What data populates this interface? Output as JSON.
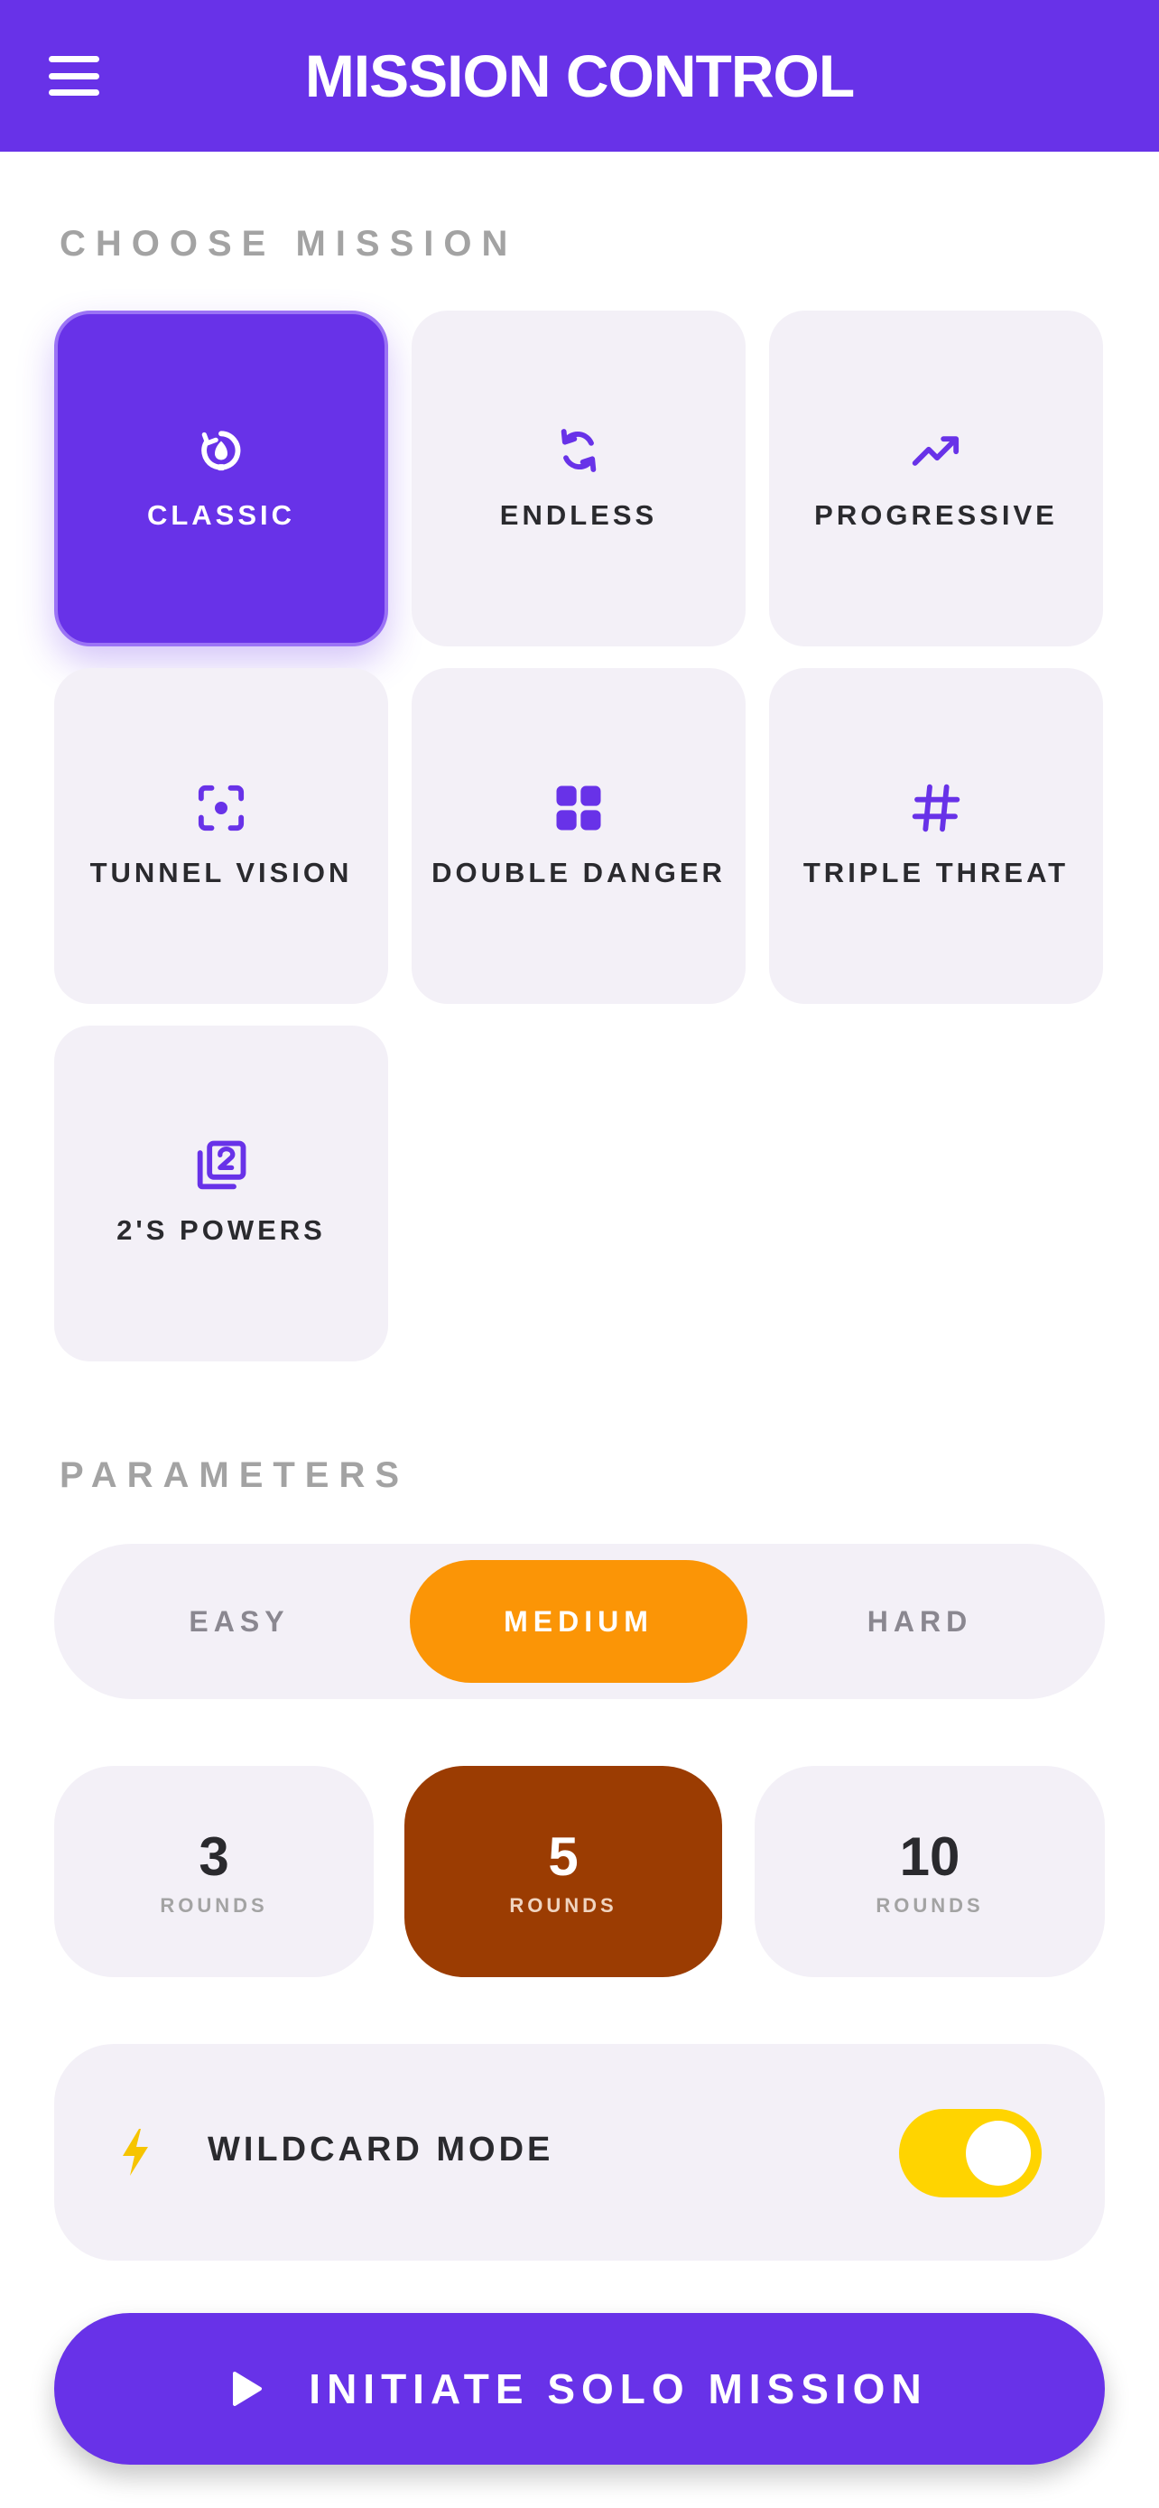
{
  "header": {
    "title": "MISSION CONTROL",
    "menu_icon": "hamburger-menu-icon"
  },
  "sections": {
    "mission_label": "CHOOSE MISSION",
    "parameters_label": "PARAMETERS"
  },
  "missions": [
    {
      "label": "CLASSIC",
      "icon": "classic-icon",
      "selected": true
    },
    {
      "label": "ENDLESS",
      "icon": "refresh-icon",
      "selected": false
    },
    {
      "label": "PROGRESSIVE",
      "icon": "trending-up-icon",
      "selected": false
    },
    {
      "label": "TUNNEL VISION",
      "icon": "focus-icon",
      "selected": false
    },
    {
      "label": "DOUBLE DANGER",
      "icon": "grid-icon",
      "selected": false
    },
    {
      "label": "TRIPLE THREAT",
      "icon": "hashtag-icon",
      "selected": false
    },
    {
      "label": "2'S POWERS",
      "icon": "filter-2-icon",
      "selected": false
    }
  ],
  "difficulty": {
    "options": [
      "EASY",
      "MEDIUM",
      "HARD"
    ],
    "selected": "MEDIUM"
  },
  "rounds": {
    "options": [
      {
        "value": "3",
        "unit": "ROUNDS"
      },
      {
        "value": "5",
        "unit": "ROUNDS"
      },
      {
        "value": "10",
        "unit": "ROUNDS"
      }
    ],
    "selected": "5"
  },
  "wildcard": {
    "label": "WILDCARD MODE",
    "icon": "bolt-icon",
    "enabled": true
  },
  "cta": {
    "label": "INITIATE SOLO MISSION",
    "icon": "play-icon"
  },
  "colors": {
    "primary": "#6832e8",
    "tile_bg": "#f3f0f7",
    "difficulty_active": "#fb9506",
    "round_active": "#9b3c02",
    "toggle_on": "#ffd400",
    "label_gray": "#a3a3a3",
    "text_dark": "#2a2a2e"
  }
}
